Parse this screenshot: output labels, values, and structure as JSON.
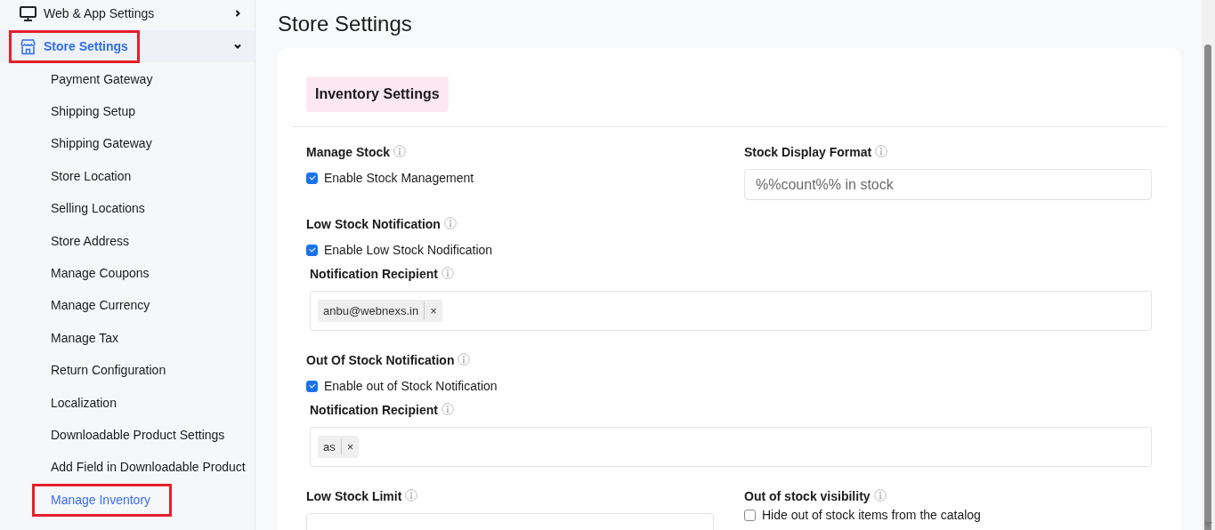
{
  "sidebar": {
    "items": [
      {
        "label": "Web & App Settings",
        "expanded": false,
        "selected": false,
        "highlighted": false
      },
      {
        "label": "Store Settings",
        "expanded": true,
        "selected": true,
        "highlighted": true,
        "children": [
          {
            "label": "Payment Gateway",
            "selected": false,
            "highlighted": false
          },
          {
            "label": "Shipping Setup",
            "selected": false,
            "highlighted": false
          },
          {
            "label": "Shipping Gateway",
            "selected": false,
            "highlighted": false
          },
          {
            "label": "Store Location",
            "selected": false,
            "highlighted": false
          },
          {
            "label": "Selling Locations",
            "selected": false,
            "highlighted": false
          },
          {
            "label": "Store Address",
            "selected": false,
            "highlighted": false
          },
          {
            "label": "Manage Coupons",
            "selected": false,
            "highlighted": false
          },
          {
            "label": "Manage Currency",
            "selected": false,
            "highlighted": false
          },
          {
            "label": "Manage Tax",
            "selected": false,
            "highlighted": false
          },
          {
            "label": "Return Configuration",
            "selected": false,
            "highlighted": false
          },
          {
            "label": "Localization",
            "selected": false,
            "highlighted": false
          },
          {
            "label": "Downloadable Product Settings",
            "selected": false,
            "highlighted": false
          },
          {
            "label": "Add Field in Downloadable Product",
            "selected": false,
            "highlighted": false
          },
          {
            "label": "Manage Inventory",
            "selected": true,
            "highlighted": true
          }
        ]
      }
    ]
  },
  "page": {
    "title": "Store Settings"
  },
  "section": {
    "title": "Inventory Settings",
    "rows": [
      {
        "cells": [
          {
            "kind": "checkbox",
            "label": "Manage Stock",
            "option": "Enable Stock Management",
            "checked": true
          },
          {
            "kind": "text",
            "label": "Stock Display Format",
            "placeholder": "%%count%% in stock"
          }
        ]
      },
      {
        "cells": [
          {
            "kind": "checkbox",
            "label": "Low Stock Notification",
            "option": "Enable Low Stock Nodification",
            "checked": true,
            "recipient": {
              "label": "Notification Recipient",
              "tags": [
                {
                  "text": "anbu@webnexs.in",
                  "remove": "×"
                }
              ]
            }
          }
        ]
      },
      {
        "cells": [
          {
            "kind": "checkbox",
            "label": "Out Of Stock Notification",
            "option": "Enable out of Stock Notification",
            "checked": true,
            "recipient": {
              "label": "Notification Recipient",
              "tags": [
                {
                  "text": "as",
                  "remove": "×"
                }
              ]
            }
          }
        ]
      },
      {
        "cells": [
          {
            "kind": "text",
            "label": "Low Stock Limit"
          },
          {
            "kind": "checkbox",
            "label": "Out of stock visibility",
            "option": "Hide out of stock items from the catalog",
            "checked": false
          }
        ]
      }
    ]
  }
}
